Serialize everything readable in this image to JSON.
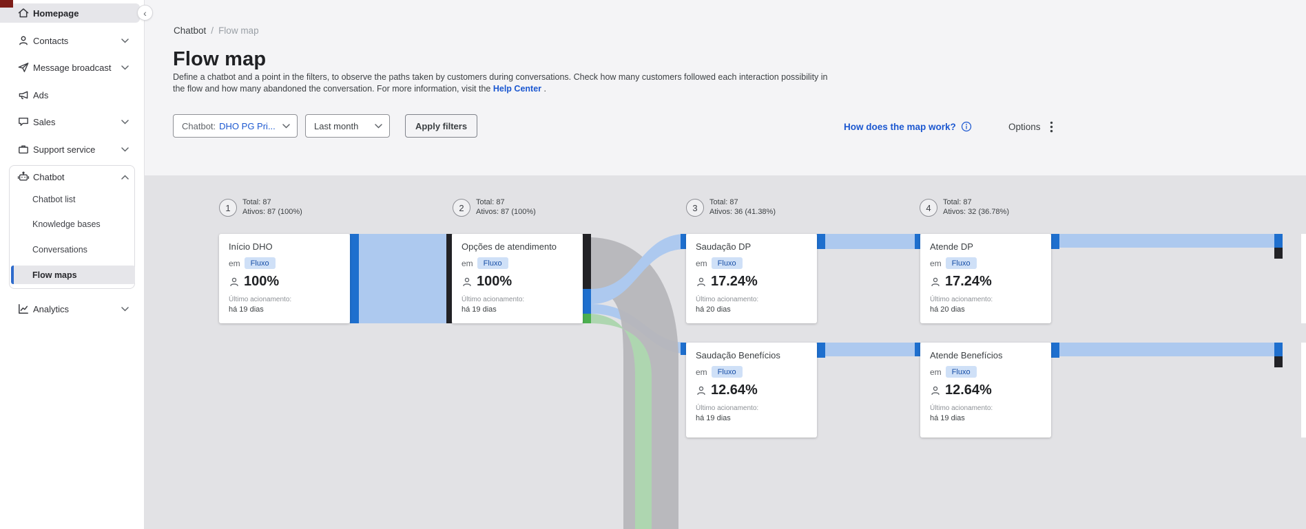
{
  "sidebar": {
    "collapse_icon": "‹",
    "items": [
      {
        "label": "Homepage"
      },
      {
        "label": "Contacts"
      },
      {
        "label": "Message broadcast"
      },
      {
        "label": "Ads"
      },
      {
        "label": "Sales"
      },
      {
        "label": "Support service"
      },
      {
        "label": "Chatbot"
      },
      {
        "label": "Analytics"
      }
    ],
    "chatbot_children": [
      {
        "label": "Chatbot list"
      },
      {
        "label": "Knowledge bases"
      },
      {
        "label": "Conversations"
      },
      {
        "label": "Flow maps"
      }
    ]
  },
  "breadcrumb": {
    "parent": "Chatbot",
    "separator": "/",
    "current": "Flow map"
  },
  "page": {
    "title": "Flow map",
    "description_line1": "Define a chatbot and a point in the filters, to observe the paths taken by customers during conversations. Check how many customers followed each interaction possibility in",
    "description_line2_pre": "the flow and how many abandoned the conversation. For more information, visit the",
    "help_link": "Help Center",
    "description_period": "."
  },
  "filters": {
    "chatbot_label": "Chatbot:",
    "chatbot_value": "DHO PG Pri...",
    "period_value": "Last month",
    "apply_label": "Apply filters",
    "map_help_label": "How does the map work?",
    "options_label": "Options"
  },
  "flow": {
    "columns": [
      {
        "number": "1",
        "total": "Total: 87",
        "actives": "Ativos: 87 (100%)"
      },
      {
        "number": "2",
        "total": "Total: 87",
        "actives": "Ativos: 87 (100%)"
      },
      {
        "number": "3",
        "total": "Total: 87",
        "actives": "Ativos: 36 (41.38%)"
      },
      {
        "number": "4",
        "total": "Total: 87",
        "actives": "Ativos: 32 (36.78%)"
      }
    ],
    "cards": [
      {
        "title": "Início DHO",
        "context_label": "em",
        "badge": "Fluxo",
        "percent": "100%",
        "last_label": "Último acionamento:",
        "last_value": "há 19 dias"
      },
      {
        "title": "Opções de atendimento",
        "context_label": "em",
        "badge": "Fluxo",
        "percent": "100%",
        "last_label": "Último acionamento:",
        "last_value": "há 19 dias"
      },
      {
        "title": "Saudação DP",
        "context_label": "em",
        "badge": "Fluxo",
        "percent": "17.24%",
        "last_label": "Último acionamento:",
        "last_value": "há 20 dias"
      },
      {
        "title": "Atende DP",
        "context_label": "em",
        "badge": "Fluxo",
        "percent": "17.24%",
        "last_label": "Último acionamento:",
        "last_value": "há 20 dias"
      },
      {
        "title": "Saudação Benefícios",
        "context_label": "em",
        "badge": "Fluxo",
        "percent": "12.64%",
        "last_label": "Último acionamento:",
        "last_value": "há 19 dias"
      },
      {
        "title": "Atende Benefícios",
        "context_label": "em",
        "badge": "Fluxo",
        "percent": "12.64%",
        "last_label": "Último acionamento:",
        "last_value": "há 19 dias"
      }
    ]
  },
  "colors": {
    "accent_blue": "#1b57d0",
    "node_blue": "#1e6fce",
    "node_black": "#222226",
    "ribbon_blue": "#adc9ef",
    "ribbon_gray": "#b6b6bb",
    "ribbon_green": "#aed6b0",
    "badge_bg": "#cfe0f7",
    "badge_text": "#174ea6",
    "top_accent_red": "#7d1d18"
  }
}
